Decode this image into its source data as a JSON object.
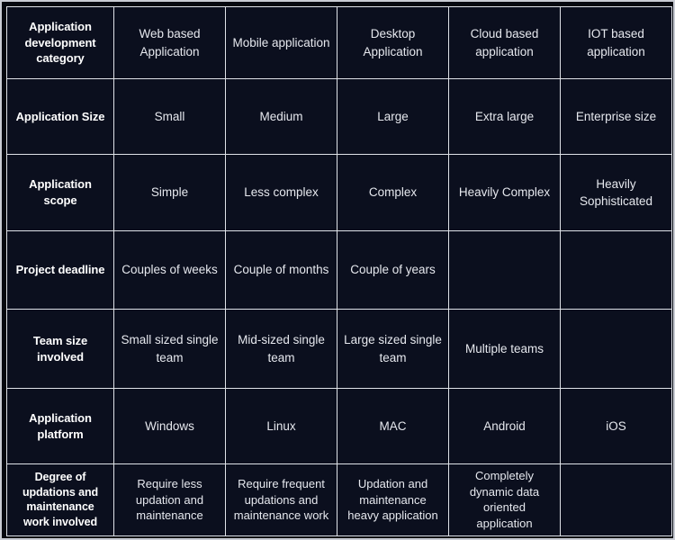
{
  "table": {
    "name": "Application development category comparison",
    "colors": {
      "background": "#0b0f1e",
      "gridline": "#dfe2e8",
      "label_text": "#ffffff",
      "value_text": "#e6e8ee",
      "outer_frame": "#c9ccd4",
      "page_background": "#050810"
    },
    "rows": [
      {
        "label": "Application development category",
        "values": [
          "Web based Application",
          "Mobile application",
          "Desktop Application",
          "Cloud based application",
          "IOT based application"
        ]
      },
      {
        "label": "Application Size",
        "values": [
          "Small",
          "Medium",
          "Large",
          "Extra large",
          "Enterprise size"
        ]
      },
      {
        "label": "Application scope",
        "values": [
          "Simple",
          "Less complex",
          "Complex",
          "Heavily Complex",
          "Heavily Sophisticated"
        ]
      },
      {
        "label": "Project deadline",
        "values": [
          "Couples of weeks",
          "Couple of months",
          "Couple of years",
          "",
          ""
        ]
      },
      {
        "label": "Team size involved",
        "values": [
          "Small sized single team",
          "Mid-sized single team",
          "Large sized single team",
          "Multiple teams",
          ""
        ]
      },
      {
        "label": "Application platform",
        "values": [
          "Windows",
          "Linux",
          "MAC",
          "Android",
          "iOS"
        ]
      },
      {
        "label": "Degree of updations and maintenance work involved",
        "values": [
          "Require less updation and maintenance",
          "Require frequent updations and maintenance work",
          "Updation and maintenance heavy application",
          "Completely dynamic data oriented application",
          ""
        ]
      }
    ]
  }
}
